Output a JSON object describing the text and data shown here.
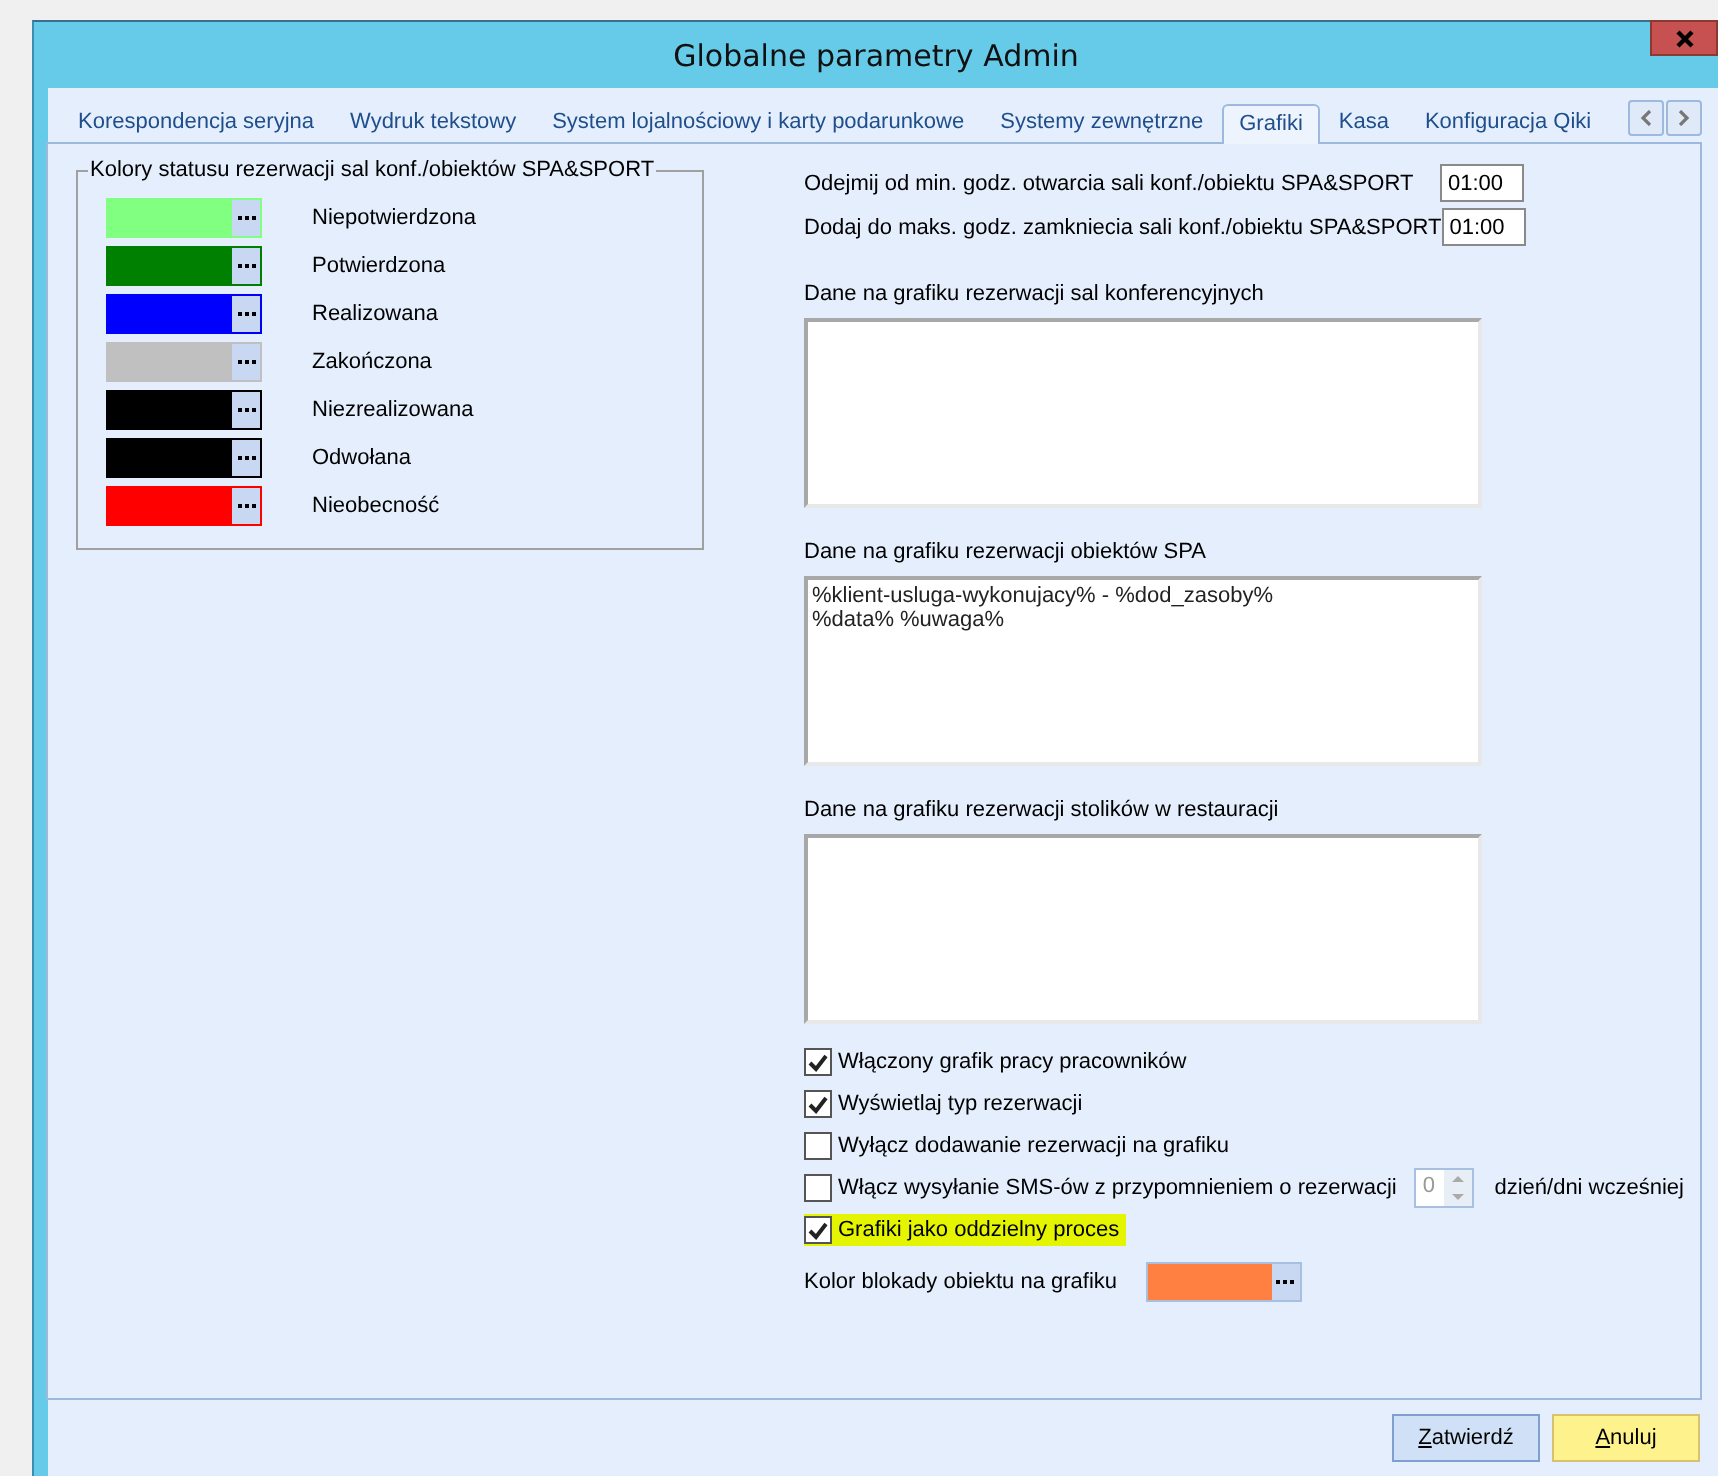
{
  "window": {
    "title": "Globalne parametry Admin"
  },
  "tabs": [
    {
      "label": "Korespondencja seryjna",
      "selected": false
    },
    {
      "label": "Wydruk tekstowy",
      "selected": false
    },
    {
      "label": "System lojalnościowy i karty podarunkowe",
      "selected": false
    },
    {
      "label": "Systemy zewnętrzne",
      "selected": false
    },
    {
      "label": "Grafiki",
      "selected": true
    },
    {
      "label": "Kasa",
      "selected": false
    },
    {
      "label": "Konfiguracja Qiki",
      "selected": false
    }
  ],
  "status_colors": {
    "title": "Kolory statusu rezerwacji sal konf./obiektów SPA&SPORT",
    "items": [
      {
        "label": "Niepotwierdzona",
        "color": "#80ff80"
      },
      {
        "label": "Potwierdzona",
        "color": "#008000"
      },
      {
        "label": "Realizowana",
        "color": "#0000ff"
      },
      {
        "label": "Zakończona",
        "color": "#c0c0c0"
      },
      {
        "label": "Niezrealizowana",
        "color": "#000000"
      },
      {
        "label": "Odwołana",
        "color": "#000000"
      },
      {
        "label": "Nieobecność",
        "color": "#ff0000"
      }
    ]
  },
  "hours": [
    {
      "label": "Odejmij od min. godz. otwarcia sali konf./obiektu SPA&SPORT",
      "value": "01:00"
    },
    {
      "label": "Dodaj do maks. godz. zamkniecia sali konf./obiektu SPA&SPORT",
      "value": "01:00"
    }
  ],
  "text_areas": [
    {
      "label": "Dane na grafiku rezerwacji sal konferencyjnych"
    },
    {
      "label": "Dane na grafiku rezerwacji obiektów SPA",
      "value": "%klient-usluga-wykonujacy% - %dod_zasoby%\n%data% %uwaga%"
    },
    {
      "label": "Dane na grafiku rezerwacji stolików w restauracji"
    }
  ],
  "checkboxes": [
    {
      "kind": "plain",
      "label": "Włączony grafik pracy pracowników",
      "checked": true,
      "highlighted": false
    },
    {
      "kind": "plain",
      "label": "Wyświetlaj typ rezerwacji",
      "checked": true,
      "highlighted": false
    },
    {
      "kind": "plain",
      "label": "Wyłącz dodawanie rezerwacji na grafiku",
      "checked": false,
      "highlighted": false
    },
    {
      "kind": "days",
      "label": "Włącz wysyłanie SMS-ów z przypomnieniem o rezerwacji",
      "checked": false,
      "highlighted": false,
      "days": {
        "value": "0",
        "suffix": "dzień/dni wcześniej"
      }
    },
    {
      "kind": "plain",
      "label": "Grafiki jako oddzielny proces",
      "checked": true,
      "highlighted": true
    }
  ],
  "block_color": {
    "label": "Kolor blokady obiektu na grafiku",
    "color": "#ff8040"
  },
  "buttons": [
    {
      "kind": "default",
      "label": "Zatwierdź"
    },
    {
      "kind": "cancel",
      "label": "Anuluj"
    }
  ]
}
